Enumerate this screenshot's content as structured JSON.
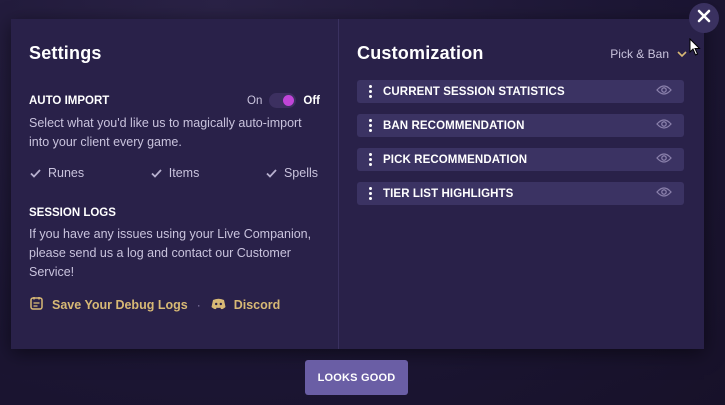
{
  "settings": {
    "title": "Settings",
    "auto_import": {
      "label": "AUTO IMPORT",
      "toggle_on": "On",
      "toggle_off": "Off",
      "description": "Select what you'd like us to magically auto-import into your client every game.",
      "options": [
        {
          "label": "Runes",
          "checked": true
        },
        {
          "label": "Items",
          "checked": true
        },
        {
          "label": "Spells",
          "checked": true
        }
      ]
    },
    "session_logs": {
      "label": "SESSION LOGS",
      "description": "If you have any issues using your Live Companion, please send us a log and contact our Customer Service!",
      "debug_link": "Save Your Debug Logs",
      "separator": "·",
      "discord_link": "Discord"
    }
  },
  "customization": {
    "title": "Customization",
    "mode": "Pick & Ban",
    "items": [
      {
        "label": "CURRENT SESSION STATISTICS",
        "icon": "eye-icon"
      },
      {
        "label": "BAN RECOMMENDATION",
        "icon": "eye-icon"
      },
      {
        "label": "PICK RECOMMENDATION",
        "icon": "eye-icon"
      },
      {
        "label": "TIER LIST HIGHLIGHTS",
        "icon": "eye-icon"
      }
    ]
  },
  "footer": {
    "confirm_label": "LOOKS GOOD"
  },
  "colors": {
    "modal_bg": "#292149",
    "accent_toggle": "#c045d8",
    "link_gold": "#d8b975",
    "button_bg": "#6a5ea5"
  }
}
